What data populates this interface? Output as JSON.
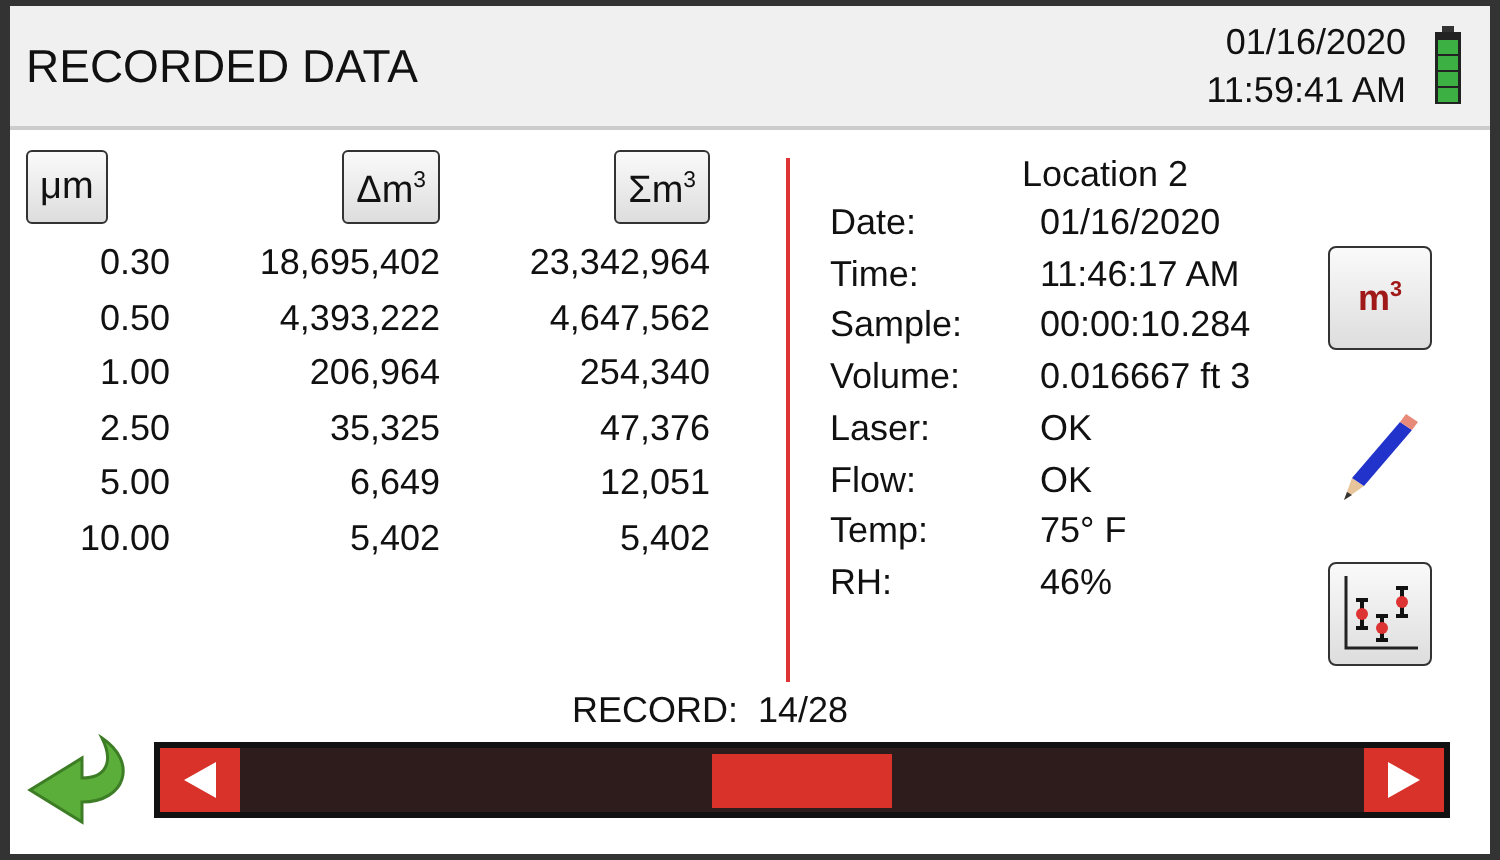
{
  "header": {
    "title": "RECORDED DATA",
    "date": "01/16/2020",
    "time": "11:59:41 AM"
  },
  "table": {
    "columns": [
      "μm",
      "Δm$^{3}$",
      "Σm$^{3}$"
    ],
    "rows": [
      [
        "0.30",
        "18,695,402",
        "23,342,964"
      ],
      [
        "0.50",
        "4,393,222",
        "4,647,562"
      ],
      [
        "1.00",
        "206,964",
        "254,340"
      ],
      [
        "2.50",
        "35,325",
        "47,376"
      ],
      [
        "5.00",
        "6,649",
        "12,051"
      ],
      [
        "10.00",
        "5,402",
        "5,402"
      ]
    ]
  },
  "info": {
    "title": "Location 2",
    "fields": [
      {
        "label": "Date:",
        "value": "01/16/2020"
      },
      {
        "label": "Time:",
        "value": "11:46:17 AM"
      },
      {
        "label": "Sample:",
        "value": "00:00:10.284"
      },
      {
        "label": "Volume:",
        "value": "0.016667 ft 3"
      },
      {
        "label": "Laser:",
        "value": "OK"
      },
      {
        "label": "Flow:",
        "value": "OK"
      },
      {
        "label": "Temp:",
        "value": "75° F"
      },
      {
        "label": "RH:",
        "value": "46%"
      }
    ]
  },
  "unit_button": "m$^{3}$",
  "record": {
    "label": "RECORD:",
    "value": "14/28"
  }
}
